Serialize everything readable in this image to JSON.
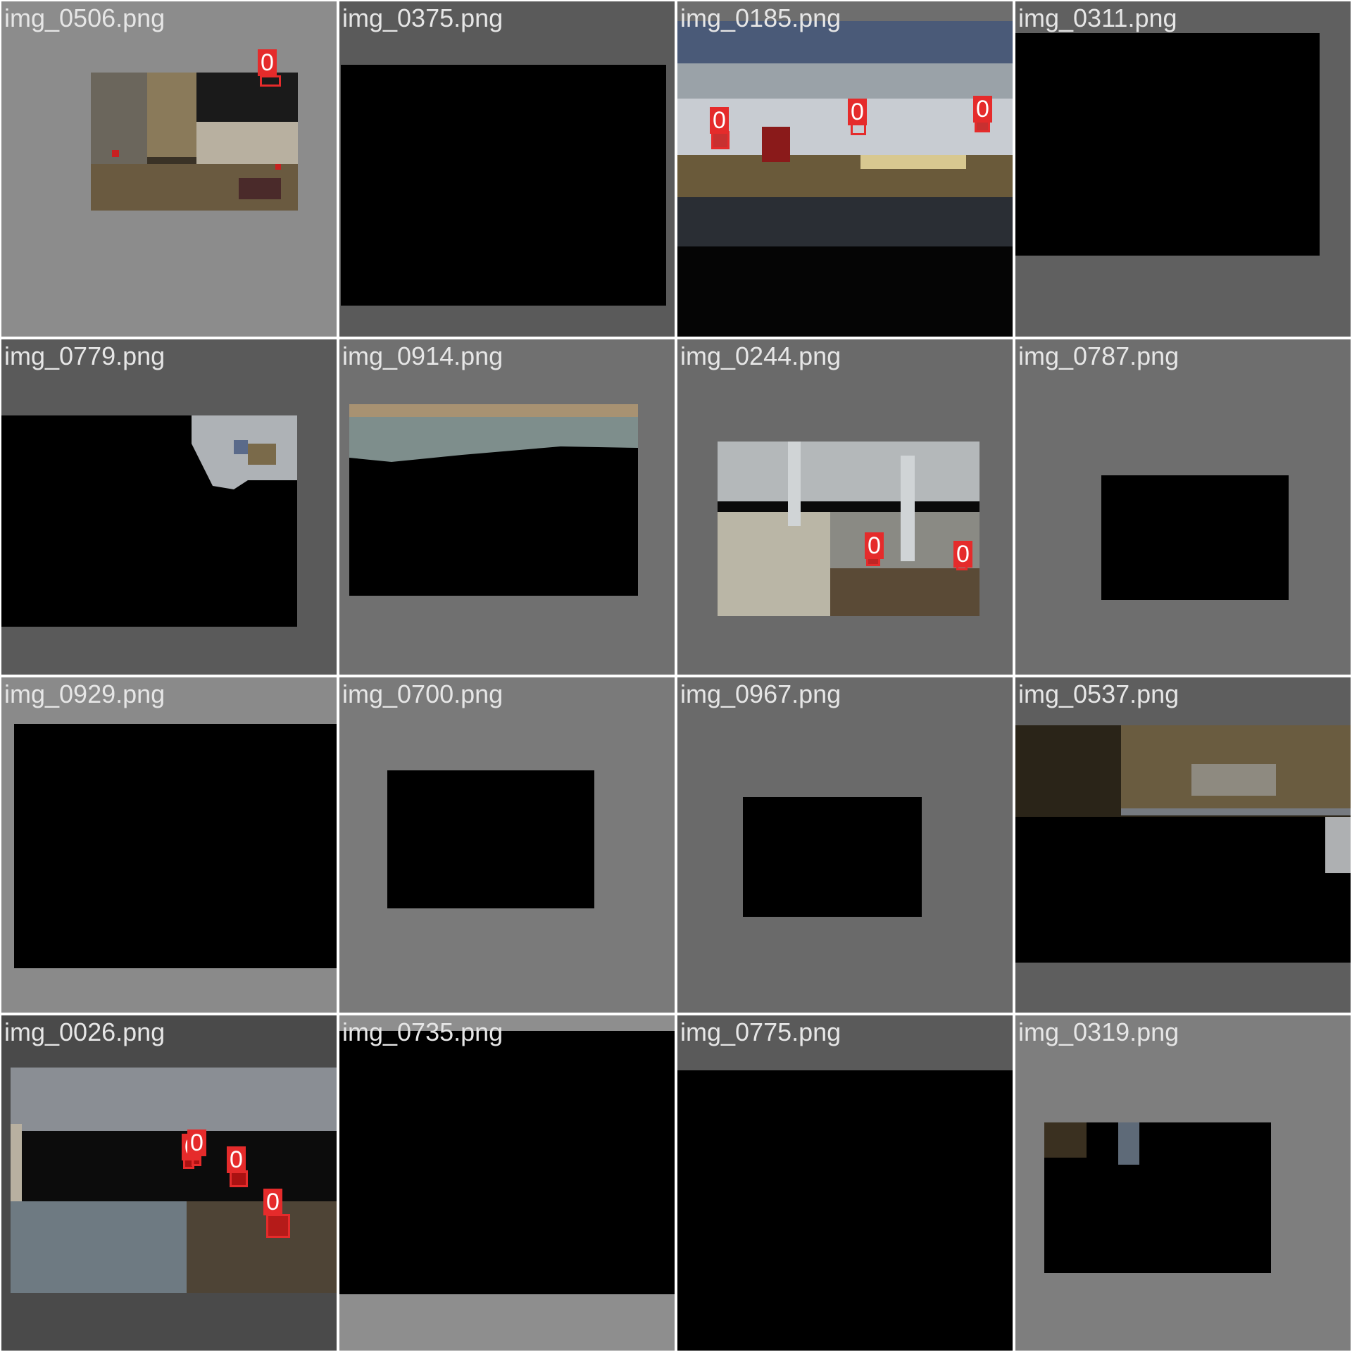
{
  "grid": {
    "cells": [
      {
        "filename": "img_0506.png",
        "background": "#8c8c8c",
        "detections": [
          "0"
        ]
      },
      {
        "filename": "img_0375.png",
        "background": "#5a5a5a",
        "detections": []
      },
      {
        "filename": "img_0185.png",
        "background": "#6e6e6e",
        "detections": [
          "0",
          "0",
          "0"
        ]
      },
      {
        "filename": "img_0311.png",
        "background": "#606060",
        "detections": []
      },
      {
        "filename": "img_0779.png",
        "background": "#5a5a5a",
        "detections": []
      },
      {
        "filename": "img_0914.png",
        "background": "#707070",
        "detections": []
      },
      {
        "filename": "img_0244.png",
        "background": "#6a6a6a",
        "detections": [
          "0",
          "0"
        ]
      },
      {
        "filename": "img_0787.png",
        "background": "#6e6e6e",
        "detections": []
      },
      {
        "filename": "img_0929.png",
        "background": "#8a8a8a",
        "detections": []
      },
      {
        "filename": "img_0700.png",
        "background": "#7a7a7a",
        "detections": []
      },
      {
        "filename": "img_0967.png",
        "background": "#6a6a6a",
        "detections": []
      },
      {
        "filename": "img_0537.png",
        "background": "#5e5e5e",
        "detections": []
      },
      {
        "filename": "img_0026.png",
        "background": "#4a4a4a",
        "detections": [
          "0",
          "0",
          "0",
          "0"
        ]
      },
      {
        "filename": "img_0735.png",
        "background": "#8e8e8e",
        "detections": []
      },
      {
        "filename": "img_0775.png",
        "background": "#5a5a5a",
        "detections": []
      },
      {
        "filename": "img_0319.png",
        "background": "#7e7e7e",
        "detections": []
      }
    ]
  },
  "colors": {
    "detection": "#e52b2b",
    "label_text": "#e6e6e6",
    "image_fill": "#000000"
  }
}
